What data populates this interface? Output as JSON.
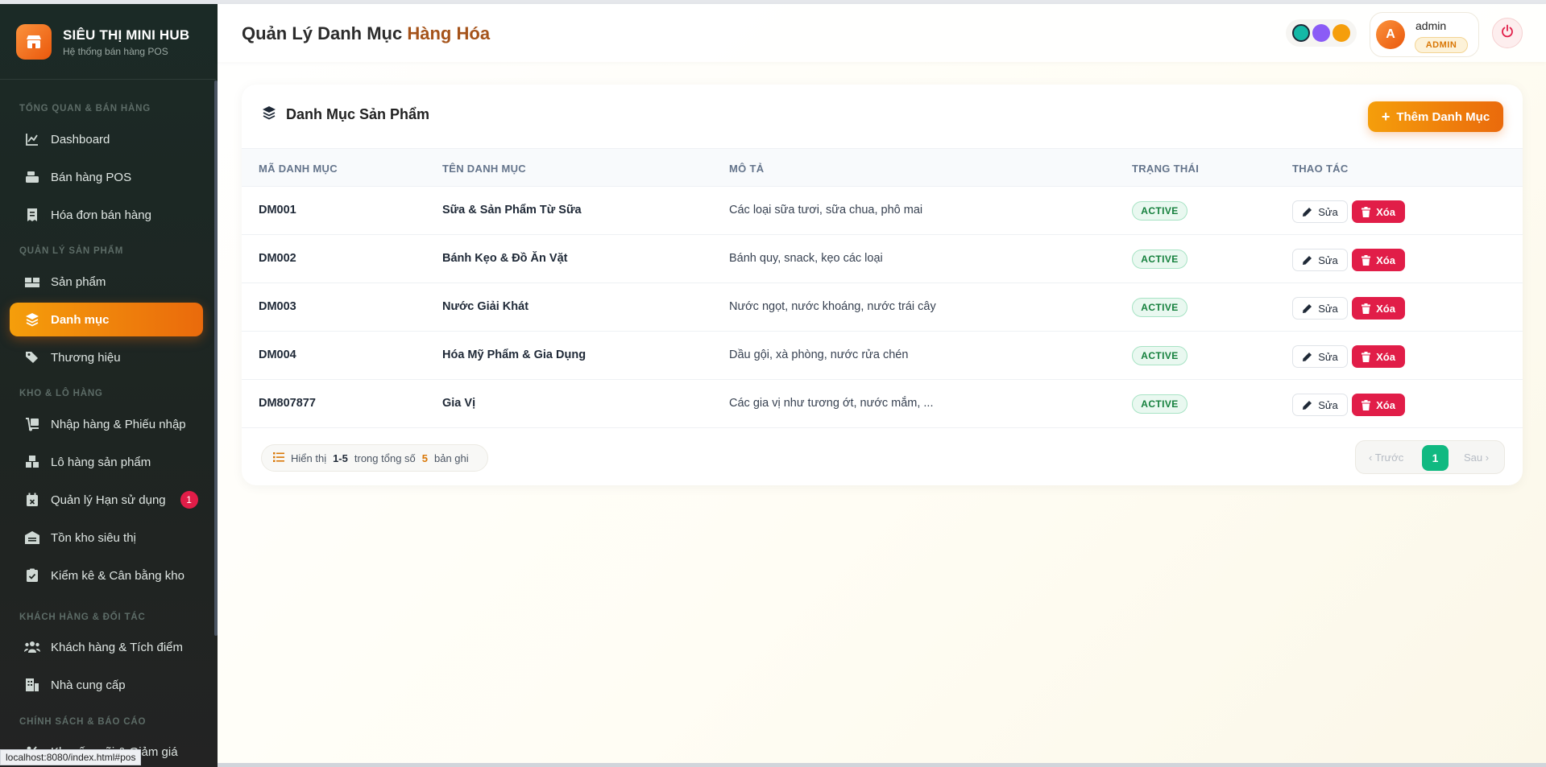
{
  "sidebar": {
    "brand_title": "SIÊU THỊ MINI HUB",
    "brand_subtitle": "Hệ thống bán hàng POS",
    "sections": {
      "overview": "TỔNG QUAN & BÁN HÀNG",
      "products": "QUẢN LÝ SẢN PHẨM",
      "inventory": "KHO & LÔ HÀNG",
      "customers": "KHÁCH HÀNG & ĐỐI TÁC",
      "policy": "CHÍNH SÁCH & BÁO CÁO"
    },
    "items": {
      "dashboard": "Dashboard",
      "pos": "Bán hàng POS",
      "invoices": "Hóa đơn bán hàng",
      "products": "Sản phẩm",
      "categories": "Danh mục",
      "brands": "Thương hiệu",
      "import": "Nhập hàng & Phiếu nhập",
      "batches": "Lô hàng sản phẩm",
      "expiry": "Quản lý Hạn sử dụng",
      "stock": "Tồn kho siêu thị",
      "audit": "Kiểm kê & Cân bằng kho",
      "customers": "Khách hàng & Tích điểm",
      "suppliers": "Nhà cung cấp",
      "promotions": "Khuyến mãi & Giảm giá"
    },
    "expiry_badge": "1",
    "active_item": "categories",
    "accent_color": "#ea6a0c"
  },
  "statusbar": {
    "url": "localhost:8080/index.html#pos"
  },
  "header": {
    "title_main": "Quản Lý Danh Mục",
    "title_accent": "Hàng Hóa",
    "user_initial": "A",
    "user_name": "admin",
    "user_role": "ADMIN",
    "theme_colors": [
      "#14b8a6",
      "#8b5cf6",
      "#f59e0b"
    ]
  },
  "card": {
    "title": "Danh Mục Sản Phẩm",
    "add_button": "Thêm Danh Mục"
  },
  "table": {
    "columns": {
      "code": "MÃ DANH MỤC",
      "name": "TÊN DANH MỤC",
      "desc": "MÔ TẢ",
      "status": "TRẠNG THÁI",
      "actions": "THAO TÁC"
    },
    "rows": [
      {
        "code": "DM001",
        "name": "Sữa & Sản Phẩm Từ Sữa",
        "desc": "Các loại sữa tươi, sữa chua, phô mai",
        "status": "ACTIVE"
      },
      {
        "code": "DM002",
        "name": "Bánh Kẹo & Đồ Ăn Vặt",
        "desc": "Bánh quy, snack, kẹo các loại",
        "status": "ACTIVE"
      },
      {
        "code": "DM003",
        "name": "Nước Giải Khát",
        "desc": "Nước ngọt, nước khoáng, nước trái cây",
        "status": "ACTIVE"
      },
      {
        "code": "DM004",
        "name": "Hóa Mỹ Phẩm & Gia Dụng",
        "desc": "Dầu gội, xà phòng, nước rửa chén",
        "status": "ACTIVE"
      },
      {
        "code": "DM807877",
        "name": "Gia Vị",
        "desc": "Các gia vị như tương ớt, nước mắm, ...",
        "status": "ACTIVE"
      }
    ],
    "edit_label": "Sửa",
    "delete_label": "Xóa"
  },
  "footer": {
    "showing_label": "Hiển thị",
    "range": "1-5",
    "of_label": "trong tổng số",
    "total": "5",
    "records_label": "bản ghi",
    "prev_label": "Trước",
    "next_label": "Sau",
    "current_page": "1"
  }
}
